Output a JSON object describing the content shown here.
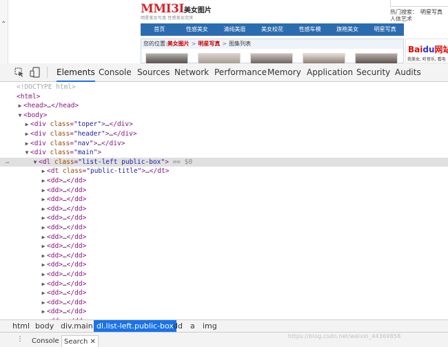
{
  "page": {
    "logo": {
      "brand": "MMI3I",
      "suffix": "美女图片",
      "slogan": "明星美女写真 性感美女欣赏"
    },
    "hot_search": {
      "label": "热门搜索：",
      "items": [
        "明星写真",
        "人体艺术"
      ]
    },
    "nav": [
      "首页",
      "性感美女",
      "清纯美眉",
      "美女校花",
      "性感车模",
      "旗袍美女",
      "明星写真"
    ],
    "breadcrumb": {
      "prefix": "您的位置:",
      "crumbs": [
        "美女图片",
        "明星写真"
      ],
      "current": "图集列表",
      "sep": ">"
    },
    "ad": {
      "logo_red": "Bai",
      "logo_blue": "du",
      "logo_tail": "网站",
      "text": "我美女, 听音乐, 看电"
    }
  },
  "devtools": {
    "tabs": [
      "Elements",
      "Console",
      "Sources",
      "Network",
      "Performance",
      "Memory",
      "Application",
      "Security",
      "Audits"
    ],
    "active_tab": "Elements",
    "dom": {
      "doctype": "<!DOCTYPE html>",
      "html": "html",
      "head": "head",
      "body": "body",
      "div_class": "div",
      "class_attr": "class",
      "toper": "\"toper\"",
      "header": "\"header\"",
      "nav": "\"nav\"",
      "main": "\"main\"",
      "dl": "dl",
      "dl_class": "\"list-left public-box\"",
      "selected_marker": "== $0",
      "dt": "dt",
      "dt_class": "\"public-title\"",
      "dd": "dd",
      "ellipsis": "…"
    },
    "breadcrumbs": [
      "html",
      "body",
      "div.main",
      "dl.list-left.public-box",
      "dd",
      "a",
      "img"
    ],
    "active_crumb": "dl.list-left.public-box",
    "drawer": {
      "menu_glyph": "⋮",
      "tabs": [
        "Console",
        "Search"
      ],
      "active": "Search",
      "close": "✕"
    },
    "watermark": "https://blog.csdn.net/weixin_44369858"
  }
}
